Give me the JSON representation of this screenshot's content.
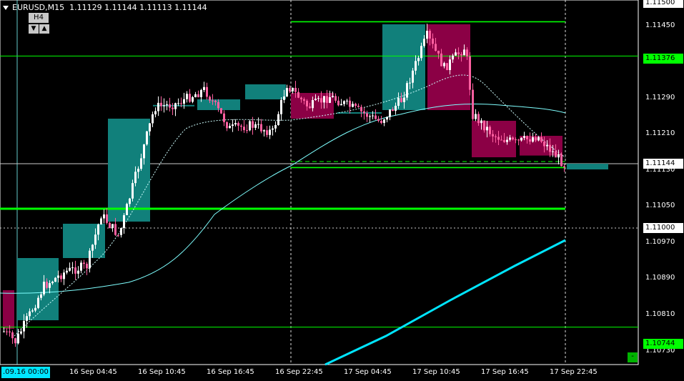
{
  "symbol": "EURUSD",
  "timeframe": "M15",
  "ohlc": "1.11129 1.11144 1.11113 1.11144",
  "tf_selector": {
    "label": "H4",
    "down": "▼",
    "up": "▲"
  },
  "price_axis": [
    "1.11450",
    "1.11290",
    "1.11210",
    "1.11050",
    "1.10970",
    "1.10890",
    "1.10810",
    "1.10730"
  ],
  "price_tags": [
    {
      "text": "1.11500",
      "style": "box"
    },
    {
      "text": "1.11376",
      "style": "green"
    },
    {
      "text": "1.11144",
      "style": "box"
    },
    {
      "text": "1.11130",
      "style": "plain"
    },
    {
      "text": "1.11000",
      "style": "box"
    },
    {
      "text": "1.10744",
      "style": "green"
    }
  ],
  "time_axis": [
    ".09.16 00:00",
    "16 Sep 04:45",
    "16 Sep 10:45",
    "16 Sep 16:45",
    "16 Sep 22:45",
    "17 Sep 04:45",
    "17 Sep 10:45",
    "17 Sep 16:45",
    "17 Sep 22:45"
  ],
  "corner_button": "-",
  "colors": {
    "up": "#11807b",
    "down": "#8b0045",
    "candle_up": "#ffffff",
    "candle_down": "#ff5fa0",
    "level": "#00ff00",
    "ma": "#7fffff",
    "ma_thick": "#00e5ff"
  },
  "chart_data": {
    "type": "candlestick",
    "title": "EURUSD,M15",
    "ylim": [
      1.107,
      1.1151
    ],
    "levels": [
      1.11456,
      1.11376,
      1.11144,
      1.1113,
      1.11116,
      1.1102,
      1.10744
    ],
    "h4_bars": [
      {
        "t": "16 Sep 00:00",
        "o": 1.1083,
        "h": 1.1083,
        "l": 1.1074,
        "c": 1.1074
      },
      {
        "t": "16 Sep 01:00",
        "o": 1.1076,
        "h": 1.10905,
        "l": 1.1076,
        "c": 1.10905
      },
      {
        "t": "16 Sep 04:00",
        "o": 1.10905,
        "h": 1.10985,
        "l": 1.10905,
        "c": 1.10985
      },
      {
        "t": "16 Sep 08:00",
        "o": 1.1099,
        "h": 1.1123,
        "l": 1.1099,
        "c": 1.1123
      },
      {
        "t": "16 Sep 12:00",
        "o": 1.11262,
        "h": 1.11262,
        "l": 1.11262,
        "c": 1.11262
      },
      {
        "t": "16 Sep 16:00",
        "o": 1.1125,
        "h": 1.11275,
        "l": 1.1125,
        "c": 1.11275
      },
      {
        "t": "16 Sep 20:00",
        "o": 1.11275,
        "h": 1.1131,
        "l": 1.11275,
        "c": 1.1131
      },
      {
        "t": "17 Sep 00:00",
        "o": 1.1129,
        "h": 1.1129,
        "l": 1.1123,
        "c": 1.1123
      },
      {
        "t": "17 Sep 04:00",
        "o": 1.11245,
        "h": 1.11245,
        "l": 1.11245,
        "c": 1.11245
      },
      {
        "t": "17 Sep 08:00",
        "o": 1.1125,
        "h": 1.1145,
        "l": 1.1125,
        "c": 1.1145
      },
      {
        "t": "17 Sep 12:00",
        "o": 1.1145,
        "h": 1.1145,
        "l": 1.1125,
        "c": 1.1125
      },
      {
        "t": "17 Sep 16:00",
        "o": 1.11225,
        "h": 1.11225,
        "l": 1.1114,
        "c": 1.1114
      },
      {
        "t": "17 Sep 20:00",
        "o": 1.1119,
        "h": 1.1119,
        "l": 1.11144,
        "c": 1.11144
      }
    ]
  }
}
